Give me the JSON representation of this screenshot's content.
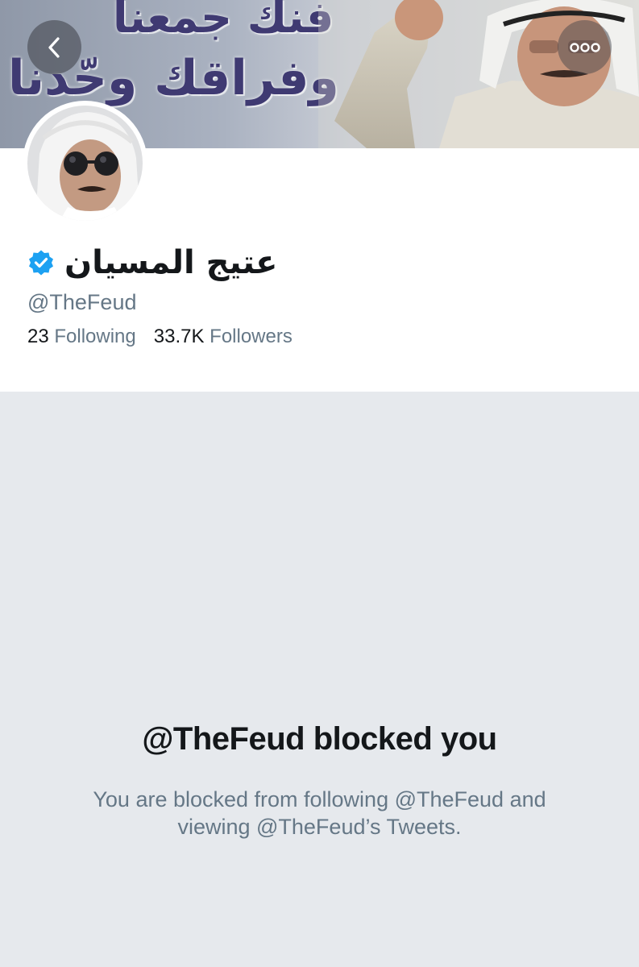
{
  "banner": {
    "line1": "فنك جمعنا",
    "line2": "وفراقك وحّدنا"
  },
  "icons": {
    "back": "chevron-left-icon",
    "more": "more-dots-icon",
    "verified": "verified-badge-icon"
  },
  "colors": {
    "verified": "#1da1f2",
    "blocked_bg": "#e6e9ed",
    "secondary_text": "#657786",
    "primary_text": "#14171a"
  },
  "profile": {
    "display_name": "عتيج المسيان",
    "handle": "@TheFeud",
    "following_count": "23",
    "following_label": "Following",
    "followers_count": "33.7K",
    "followers_label": "Followers"
  },
  "blocked": {
    "title": "@TheFeud blocked you",
    "line1": "You are blocked from following @TheFeud and",
    "line2": "viewing @TheFeud’s Tweets."
  }
}
